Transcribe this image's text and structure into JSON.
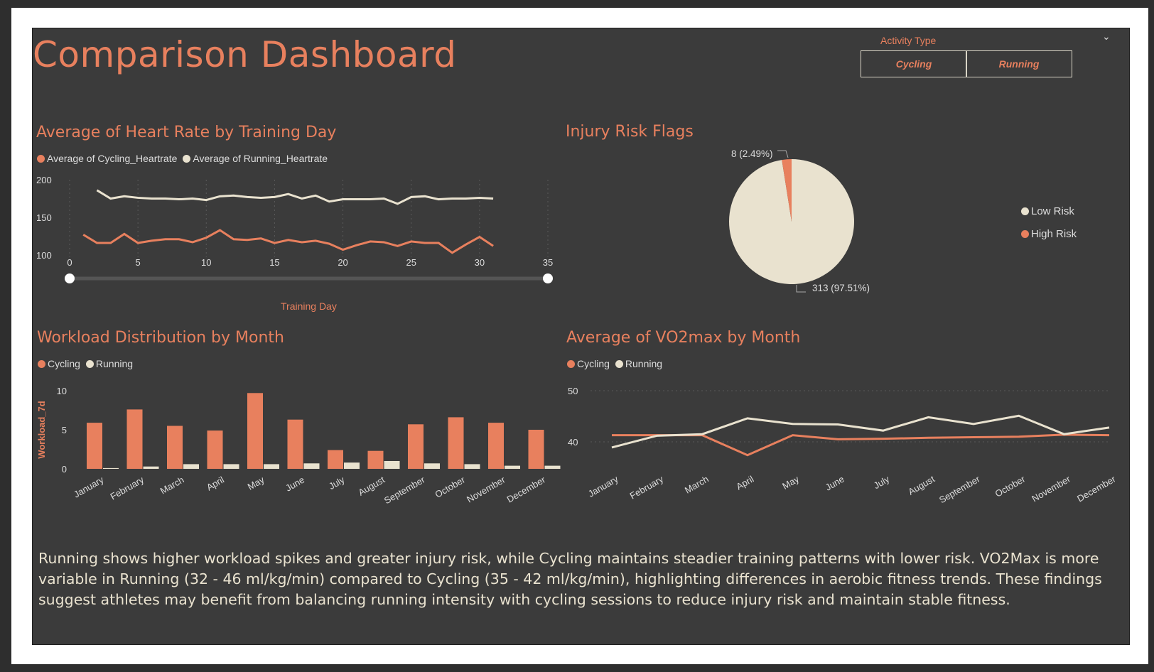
{
  "header": {
    "title": "Comparison Dashboard",
    "slicer_label": "Activity Type",
    "slicer_options": [
      "Cycling",
      "Running"
    ]
  },
  "colors": {
    "cycling": "#e8805e",
    "running": "#e9e2cf",
    "background": "#3b3b3b",
    "title": "#e8805e"
  },
  "heart_rate": {
    "title": "Average of Heart Rate by Training Day",
    "legend": [
      "Average of Cycling_Heartrate",
      "Average of Running_Heartrate"
    ],
    "xlabel": "Training Day",
    "slider": {
      "min": 0,
      "max": 35
    }
  },
  "injury": {
    "title": "Injury Risk Flags",
    "legend": [
      "Low Risk",
      "High Risk"
    ],
    "label_high": "8 (2.49%)",
    "label_low": "313 (97.51%)"
  },
  "workload": {
    "title": "Workload Distribution by Month",
    "legend": [
      "Cycling",
      "Running"
    ],
    "ylabel": "Workload_7d"
  },
  "vo2": {
    "title": "Average of VO2max by Month",
    "legend": [
      "Cycling",
      "Running"
    ]
  },
  "summary": "Running shows higher workload spikes and greater injury risk, while Cycling maintains steadier training patterns with lower risk. VO2Max is more variable in Running (32 - 46 ml/kg/min) compared to Cycling (35 - 42 ml/kg/min), highlighting differences in aerobic fitness trends. These findings suggest athletes may benefit from balancing running intensity with cycling sessions to reduce injury risk and maintain stable fitness.",
  "chart_data": [
    {
      "type": "line",
      "title": "Average of Heart Rate by Training Day",
      "xlabel": "Training Day",
      "ylabel": "",
      "xlim": [
        0,
        35
      ],
      "ylim": [
        100,
        200
      ],
      "xticks": [
        0,
        5,
        10,
        15,
        20,
        25,
        30,
        35
      ],
      "yticks": [
        100,
        150,
        200
      ],
      "x": [
        1,
        2,
        3,
        4,
        5,
        6,
        7,
        8,
        9,
        10,
        11,
        12,
        13,
        14,
        15,
        16,
        17,
        18,
        19,
        20,
        21,
        22,
        23,
        24,
        25,
        26,
        27,
        28,
        29,
        30,
        31
      ],
      "series": [
        {
          "name": "Average of Cycling_Heartrate",
          "values": [
            127,
            116,
            116,
            128,
            116,
            119,
            121,
            121,
            117,
            123,
            133,
            121,
            120,
            122,
            116,
            120,
            117,
            119,
            115,
            107,
            113,
            118,
            117,
            112,
            118,
            116,
            116,
            103,
            114,
            124,
            112
          ]
        },
        {
          "name": "Average of Running_Heartrate",
          "values": null,
          "x": [
            2,
            3,
            4,
            5,
            6,
            7,
            8,
            9,
            10,
            11,
            12,
            13,
            14,
            15,
            16,
            17,
            18,
            19,
            20,
            21,
            22,
            23,
            24,
            25,
            26,
            27,
            28,
            29,
            30,
            31
          ],
          "y": [
            186,
            175,
            178,
            176,
            175,
            175,
            174,
            175,
            173,
            178,
            179,
            177,
            176,
            177,
            181,
            175,
            179,
            171,
            174,
            174,
            174,
            175,
            168,
            177,
            178,
            174,
            175,
            175,
            176,
            175
          ]
        }
      ]
    },
    {
      "type": "pie",
      "title": "Injury Risk Flags",
      "categories": [
        "Low Risk",
        "High Risk"
      ],
      "values": [
        313,
        8
      ],
      "labels": [
        "313 (97.51%)",
        "8 (2.49%)"
      ],
      "legend": "right"
    },
    {
      "type": "bar",
      "title": "Workload Distribution by Month",
      "xlabel": "",
      "ylabel": "Workload_7d",
      "ylim": [
        0,
        10
      ],
      "yticks": [
        0,
        5,
        10
      ],
      "categories": [
        "January",
        "February",
        "March",
        "April",
        "May",
        "June",
        "July",
        "August",
        "September",
        "October",
        "November",
        "December"
      ],
      "series": [
        {
          "name": "Cycling",
          "values": [
            5.9,
            7.6,
            5.5,
            4.9,
            9.7,
            6.3,
            2.4,
            2.3,
            5.7,
            6.6,
            5.9,
            5.0
          ]
        },
        {
          "name": "Running",
          "values": [
            0.1,
            0.3,
            0.6,
            0.6,
            0.6,
            0.7,
            0.8,
            1.0,
            0.7,
            0.6,
            0.4,
            0.4
          ]
        }
      ]
    },
    {
      "type": "line",
      "title": "Average of VO2max by Month",
      "xlabel": "",
      "ylabel": "",
      "ylim": [
        30,
        50
      ],
      "yticks": [
        40,
        50
      ],
      "categories": [
        "January",
        "February",
        "March",
        "April",
        "May",
        "June",
        "July",
        "August",
        "September",
        "October",
        "November",
        "December"
      ],
      "series": [
        {
          "name": "Cycling",
          "values": [
            41.3,
            41.3,
            41.3,
            37.4,
            41.3,
            40.5,
            40.6,
            40.8,
            40.9,
            41.0,
            41.4,
            41.3
          ]
        },
        {
          "name": "Running",
          "values": [
            38.9,
            41.2,
            41.5,
            44.6,
            43.5,
            43.4,
            42.2,
            44.8,
            43.5,
            45.1,
            41.5,
            42.8
          ]
        }
      ]
    }
  ]
}
